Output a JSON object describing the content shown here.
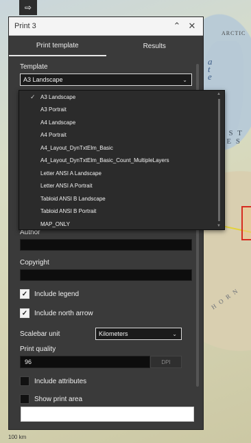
{
  "map": {
    "labels": {
      "arctic": "ARCTIC",
      "ate": "a t e",
      "est": "E S T\nI E S",
      "horn": "H O R N",
      "scale": "100 km"
    },
    "colors": {
      "boundary_yellow": "#e3d23a",
      "highlight_red": "#d62b1f"
    }
  },
  "export_icon": "export-arrow-icon",
  "window": {
    "title": "Print 3",
    "collapse_icon": "chevron-double-up-icon",
    "close_icon": "close-icon"
  },
  "tabs": [
    {
      "label": "Print template",
      "active": true
    },
    {
      "label": "Results",
      "active": false
    }
  ],
  "template": {
    "label": "Template",
    "selected": "A3 Landscape"
  },
  "dropdown": {
    "options": [
      {
        "label": "A3 Landscape",
        "checked": true
      },
      {
        "label": "A3 Portrait",
        "checked": false
      },
      {
        "label": "A4 Landscape",
        "checked": false
      },
      {
        "label": "A4 Portrait",
        "checked": false
      },
      {
        "label": "A4_Layout_DynTxtElm_Basic",
        "checked": false
      },
      {
        "label": "A4_Layout_DynTxtElm_Basic_Count_MultipleLayers",
        "checked": false
      },
      {
        "label": "Letter ANSI A Landscape",
        "checked": false
      },
      {
        "label": "Letter ANSI A Portrait",
        "checked": false
      },
      {
        "label": "Tabloid ANSI B Landscape",
        "checked": false
      },
      {
        "label": "Tabloid ANSI B Portrait",
        "checked": false
      },
      {
        "label": "MAP_ONLY",
        "checked": false
      }
    ]
  },
  "author": {
    "label": "Author",
    "value": ""
  },
  "copyright": {
    "label": "Copyright",
    "value": ""
  },
  "include_legend": {
    "label": "Include legend",
    "checked": true
  },
  "include_north_arrow": {
    "label": "Include north arrow",
    "checked": true
  },
  "scalebar": {
    "label": "Scalebar unit",
    "selected": "Kilometers"
  },
  "quality": {
    "label": "Print quality",
    "value": "96",
    "unit": "DPI"
  },
  "include_attributes": {
    "label": "Include attributes",
    "checked": false
  },
  "show_print_area": {
    "label": "Show print area",
    "checked": false
  },
  "print_button": {
    "label": ""
  }
}
